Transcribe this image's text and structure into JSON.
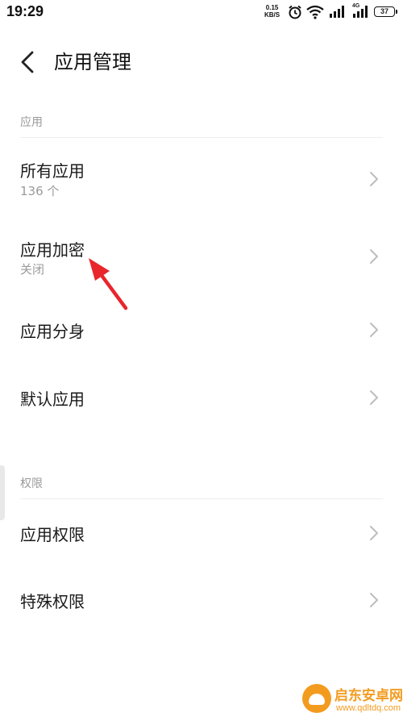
{
  "status_bar": {
    "time": "19:29",
    "speed_value": "0.15",
    "speed_unit": "KB/S",
    "network_label": "4G",
    "battery": "37"
  },
  "header": {
    "title": "应用管理"
  },
  "sections": [
    {
      "header": "应用",
      "items": [
        {
          "title": "所有应用",
          "subtitle": "136 个"
        },
        {
          "title": "应用加密",
          "subtitle": "关闭"
        },
        {
          "title": "应用分身"
        },
        {
          "title": "默认应用"
        }
      ]
    },
    {
      "header": "权限",
      "items": [
        {
          "title": "应用权限"
        },
        {
          "title": "特殊权限"
        }
      ]
    }
  ],
  "annotation": {
    "color": "#e8262c"
  },
  "watermark": {
    "name": "启东安卓网",
    "url": "www.qdltdq.com"
  },
  "colors": {
    "accent": "#f39b1f",
    "secondary_text": "#9a9a9a"
  }
}
